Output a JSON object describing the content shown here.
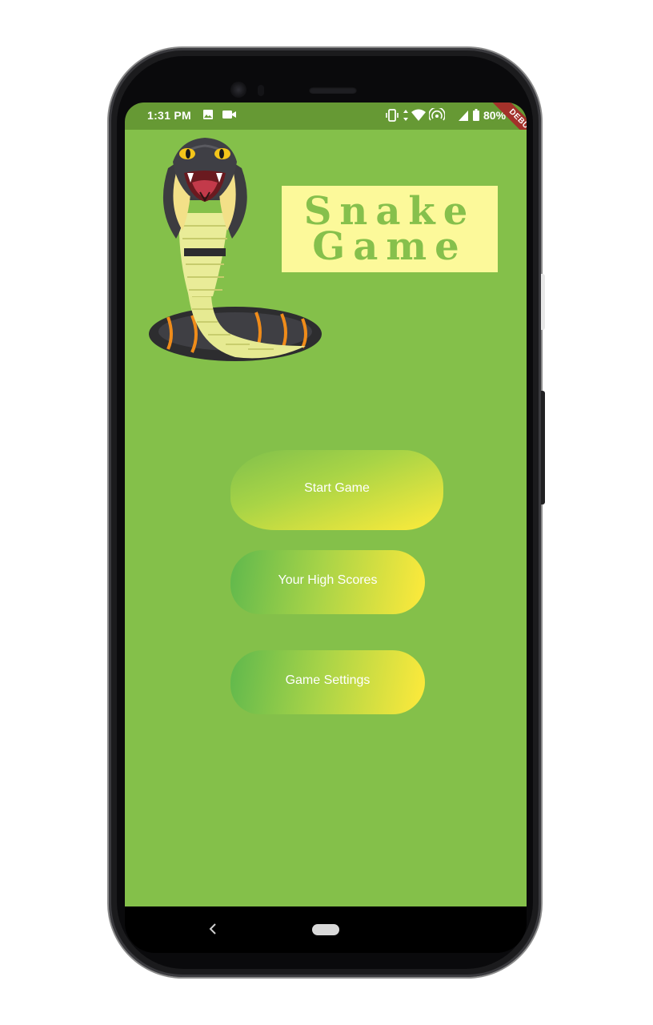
{
  "status_bar": {
    "time": "1:31 PM",
    "battery": "80%",
    "debug_banner": "DEBUG",
    "left_icons": [
      "image-icon",
      "video-icon"
    ],
    "right_icons": [
      "vibrate-icon",
      "data-arrows-icon",
      "wifi-icon",
      "hotspot-icon",
      "signal-icon",
      "battery-icon"
    ]
  },
  "app": {
    "title_line1": "Snake",
    "title_line2": "Game",
    "colors": {
      "background": "#84c04a",
      "title_box": "#fcf99a",
      "title_text": "#86c04c",
      "button_gradient_start": "#5fb84d",
      "button_gradient_end": "#ffea3b",
      "status_bar": "#669934"
    },
    "buttons": [
      {
        "label": "Start Game"
      },
      {
        "label": "Your High Scores"
      },
      {
        "label": "Game Settings"
      }
    ]
  },
  "nav_bar": {
    "back_icon": "back-chevron-icon",
    "home_icon": "home-pill-icon"
  }
}
